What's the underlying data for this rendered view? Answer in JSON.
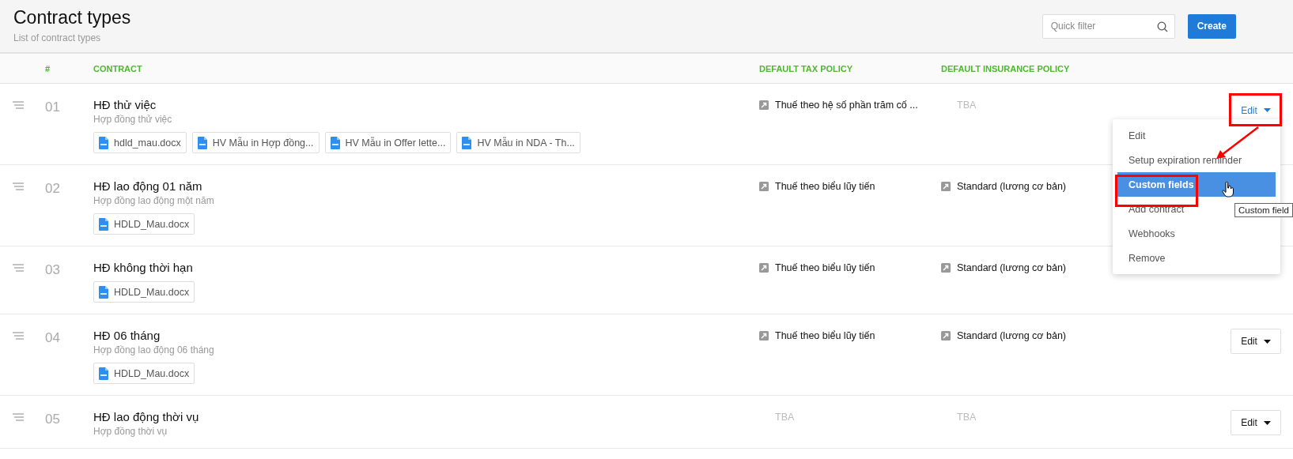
{
  "header": {
    "title": "Contract types",
    "subtitle": "List of contract types",
    "search": {
      "placeholder": "Quick filter"
    },
    "create_button": "Create"
  },
  "table": {
    "columns": [
      "#",
      "CONTRACT",
      "DEFAULT TAX POLICY",
      "DEFAULT INSURANCE POLICY"
    ],
    "rows": [
      {
        "number": "01",
        "name": "HĐ thử việc",
        "description": "Hợp đồng thử việc",
        "files": [
          "hdld_mau.docx",
          "HV Mẫu in Hợp đồng...",
          "HV Mẫu in Offer lette...",
          "HV Mẫu in NDA - Th..."
        ],
        "tax": {
          "text": "Thuế theo hệ số phần trăm cố ...",
          "linked": true
        },
        "insurance": {
          "text": "TBA",
          "linked": false
        },
        "action": {
          "label": "Edit",
          "open": true
        }
      },
      {
        "number": "02",
        "name": "HĐ lao động 01 năm",
        "description": "Hợp đồng lao động một năm",
        "files": [
          "HDLD_Mau.docx"
        ],
        "tax": {
          "text": "Thuế theo biểu lũy tiến",
          "linked": true
        },
        "insurance": {
          "text": "Standard (lương cơ bản)",
          "linked": true
        }
      },
      {
        "number": "03",
        "name": "HĐ không thời hạn",
        "files": [
          "HDLD_Mau.docx"
        ],
        "tax": {
          "text": "Thuế theo biểu lũy tiến",
          "linked": true
        },
        "insurance": {
          "text": "Standard (lương cơ bản)",
          "linked": true
        }
      },
      {
        "number": "04",
        "name": "HĐ 06 tháng",
        "description": "Hợp đồng lao động 06 tháng",
        "files": [
          "HDLD_Mau.docx"
        ],
        "tax": {
          "text": "Thuế theo biểu lũy tiến",
          "linked": true
        },
        "insurance": {
          "text": "Standard (lương cơ bản)",
          "linked": true
        },
        "action": {
          "label": "Edit",
          "open": false
        }
      },
      {
        "number": "05",
        "name": "HĐ lao động thời vụ",
        "description": "Hợp đồng thời vụ",
        "tax": {
          "text": "TBA",
          "linked": false
        },
        "insurance": {
          "text": "TBA",
          "linked": false
        },
        "action": {
          "label": "Edit",
          "open": false
        }
      }
    ]
  },
  "dropdown_menu": {
    "items": [
      {
        "label": "Edit",
        "selected": false
      },
      {
        "label": "Setup expiration reminder",
        "selected": false
      },
      {
        "label": "Custom fields",
        "selected": true
      },
      {
        "label": "Add contract",
        "selected": false
      },
      {
        "label": "Webhooks",
        "selected": false
      },
      {
        "label": "Remove",
        "selected": false
      }
    ]
  },
  "tooltip": "Custom field"
}
